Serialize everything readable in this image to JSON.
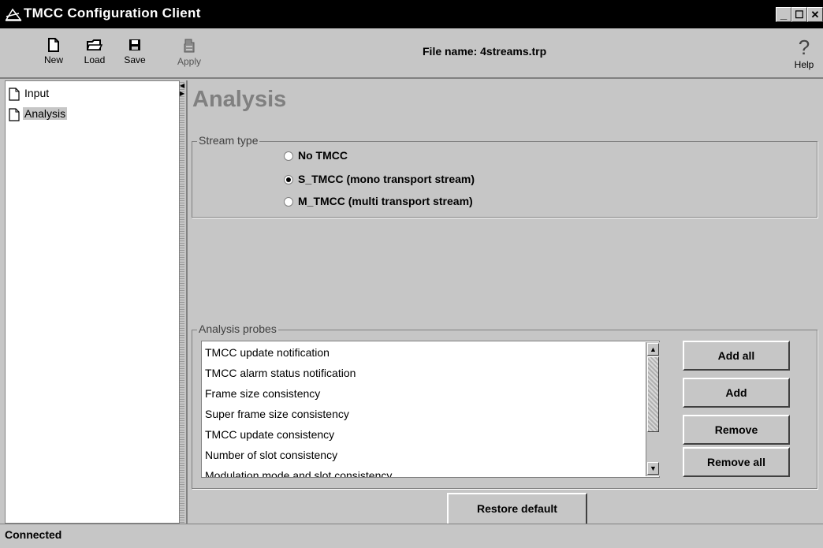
{
  "window": {
    "title": "TMCC Configuration Client",
    "controls": {
      "minimize": "_",
      "maximize": "☐",
      "close": "✕"
    }
  },
  "toolbar": {
    "new_label": "New",
    "load_label": "Load",
    "save_label": "Save",
    "apply_label": "Apply",
    "help_label": "Help",
    "help_glyph": "?",
    "file_name": "File name: 4streams.trp"
  },
  "tree": {
    "items": [
      {
        "label": "Input",
        "selected": false
      },
      {
        "label": "Analysis",
        "selected": true
      }
    ]
  },
  "splitter": {
    "arrow_left": "◀",
    "arrow_right": "▶"
  },
  "main": {
    "title": "Analysis",
    "stream_type": {
      "legend": "Stream type",
      "options": [
        {
          "label": "No TMCC",
          "selected": false
        },
        {
          "label": "S_TMCC (mono transport stream)",
          "selected": true
        },
        {
          "label": "M_TMCC (multi transport stream)",
          "selected": false
        }
      ]
    },
    "analysis_probes": {
      "legend": "Analysis probes",
      "items": [
        "TMCC update notification",
        "TMCC alarm status notification",
        "Frame size consistency",
        "Super frame size consistency",
        "TMCC update consistency",
        "Number of slot consistency",
        "Modulation mode and slot consistency"
      ],
      "scroll_up": "▲",
      "scroll_down": "▼",
      "buttons": {
        "add_all": "Add all",
        "add": "Add",
        "remove": "Remove",
        "remove_all": "Remove all"
      }
    },
    "restore_default": "Restore default"
  },
  "status": {
    "text": "Connected"
  }
}
